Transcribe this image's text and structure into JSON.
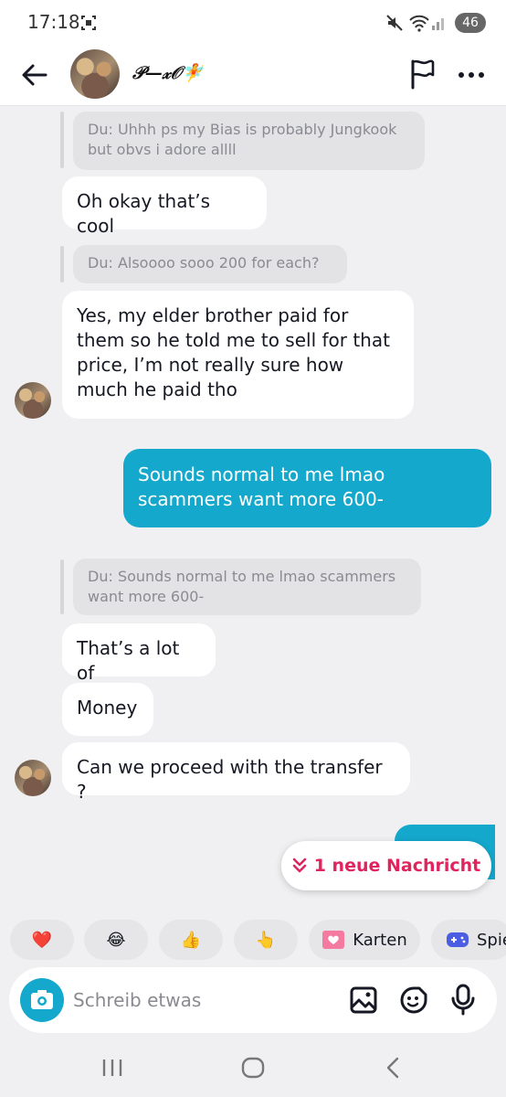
{
  "status_bar": {
    "time": "17:18",
    "battery": "46"
  },
  "header": {
    "contact_name": "𝒫—𝓍𝒪🧚"
  },
  "messages": [
    {
      "type": "quote",
      "text": "Du: Uhhh ps my Bias is probably Jungkook but obvs i adore allll"
    },
    {
      "type": "incoming",
      "text": "Oh okay that’s cool"
    },
    {
      "type": "quote",
      "text": "Du: Alsoooo sooo 200 for each?"
    },
    {
      "type": "incoming",
      "text": "Yes, my elder brother paid for them so he told me to sell for that price, I’m not really sure how much he paid tho"
    },
    {
      "type": "outgoing",
      "text": "Sounds normal to me lmao scammers want more 600-"
    },
    {
      "type": "quote",
      "text": "Du: Sounds normal to me lmao scammers want more 600-"
    },
    {
      "type": "incoming",
      "text": "That’s a lot of"
    },
    {
      "type": "incoming",
      "text": "Money"
    },
    {
      "type": "incoming",
      "text": "Can we proceed with the transfer ?"
    }
  ],
  "new_message_pill": "1 neue Nachricht",
  "quick_replies": [
    {
      "icon": "heart-emoji",
      "label": "❤️"
    },
    {
      "icon": "laughing-emoji",
      "label": "😂"
    },
    {
      "icon": "thumbs-up-emoji",
      "label": "👍"
    },
    {
      "icon": "pointing-emoji",
      "label": "👆"
    },
    {
      "icon": "cards-icon",
      "label": "Karten"
    },
    {
      "icon": "games-icon",
      "label": "Spie"
    }
  ],
  "composer": {
    "placeholder": "Schreib etwas"
  }
}
